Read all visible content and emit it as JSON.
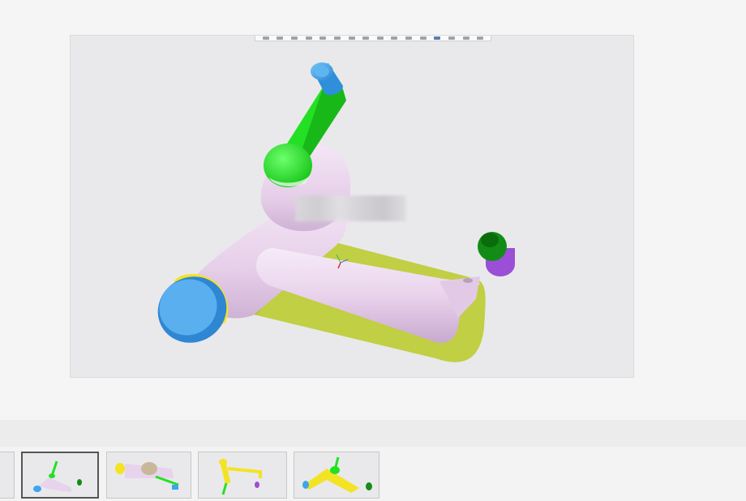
{
  "viewer": {
    "toolbar": {
      "buttons": [
        "zoom-fit-icon",
        "zoom-in-icon",
        "zoom-out-icon",
        "rotate-icon",
        "pan-icon",
        "view-front-icon",
        "view-top-icon",
        "view-iso-icon",
        "shading-icon",
        "section-icon",
        "measure-icon",
        "explode-icon",
        "display-style-icon",
        "settings-icon",
        "fullscreen-icon",
        "more-icon"
      ]
    },
    "model": {
      "description": "faucet-assembly",
      "colors": {
        "body": "#e8d3ec",
        "handle": "#2ee82e",
        "cap": "#3fa4ef",
        "ring": "#f3e325",
        "shadow": "#c2d04a",
        "knob_top": "#0e8a12",
        "knob_bottom": "#9b4fd6"
      }
    }
  },
  "thumbnails": [
    {
      "name": "view-1",
      "selected": false
    },
    {
      "name": "view-2",
      "selected": true
    },
    {
      "name": "view-3",
      "selected": false
    },
    {
      "name": "view-4",
      "selected": false
    },
    {
      "name": "view-5",
      "selected": false
    }
  ]
}
